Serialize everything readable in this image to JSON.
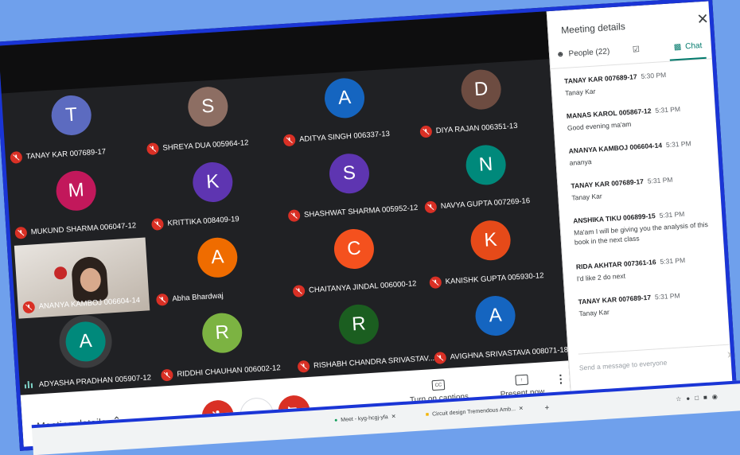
{
  "participants": [
    {
      "name": "TANAY KAR 007689-17",
      "initial": "T",
      "color": "#5c6bc0"
    },
    {
      "name": "SHREYA DUA 005964-12",
      "initial": "S",
      "color": "#8d6e63"
    },
    {
      "name": "ADITYA SINGH 006337-13",
      "initial": "A",
      "color": "#1565c0"
    },
    {
      "name": "DIYA RAJAN 006351-13",
      "initial": "D",
      "color": "#6d4c41"
    },
    {
      "name": "MUKUND SHARMA 006047-12",
      "initial": "M",
      "color": "#c2185b"
    },
    {
      "name": "KRITTIKA 008409-19",
      "initial": "K",
      "color": "#5e35b1"
    },
    {
      "name": "SHASHWAT SHARMA 005952-12",
      "initial": "S",
      "color": "#5e35b1"
    },
    {
      "name": "NAVYA GUPTA 007269-16",
      "initial": "N",
      "color": "#00897b"
    },
    {
      "name": "ANANYA KAMBOJ 006604-14",
      "initial": "",
      "color": "#000000"
    },
    {
      "name": "Abha Bhardwaj",
      "initial": "A",
      "color": "#ef6c00"
    },
    {
      "name": "CHAITANYA JINDAL 006000-12",
      "initial": "C",
      "color": "#f4511e"
    },
    {
      "name": "KANISHK GUPTA 005930-12",
      "initial": "K",
      "color": "#e64a19"
    },
    {
      "name": "ADYASHA PRADHAN 005907-12",
      "initial": "A",
      "color": "#00897b"
    },
    {
      "name": "RIDDHI CHAUHAN 006002-12",
      "initial": "R",
      "color": "#7cb342"
    },
    {
      "name": "RISHABH CHANDRA SRIVASTAV...",
      "initial": "R",
      "color": "#1b5e20"
    },
    {
      "name": "AVIGHNA SRIVASTAVA 008071-18",
      "initial": "A",
      "color": "#1565c0"
    }
  ],
  "bottom": {
    "meeting_details": "Meeting details",
    "captions": "Turn on captions",
    "captions_icon": "CC",
    "present": "Present now"
  },
  "side": {
    "title": "Meeting details",
    "people_tab": "People (22)",
    "chat_tab": "Chat",
    "send_placeholder": "Send a message to everyone"
  },
  "messages": [
    {
      "sender": "TANAY KAR 007689-17",
      "time": "5:30 PM",
      "text": "Tanay Kar"
    },
    {
      "sender": "MANAS KAROL 005867-12",
      "time": "5:31 PM",
      "text": "Good evening ma'am"
    },
    {
      "sender": "ANANYA KAMBOJ 006604-14",
      "time": "5:31 PM",
      "text": "ananya"
    },
    {
      "sender": "TANAY KAR 007689-17",
      "time": "5:31 PM",
      "text": "Tanay Kar"
    },
    {
      "sender": "ANSHIKA TIKU 006899-15",
      "time": "5:31 PM",
      "text": "Ma'am I will be giving you the analysis of this book in the next class"
    },
    {
      "sender": "RIDA AKHTAR 007361-16",
      "time": "5:31 PM",
      "text": "I'd like 2 do next"
    },
    {
      "sender": "TANAY KAR 007689-17",
      "time": "5:31 PM",
      "text": "Tanay Kar"
    }
  ],
  "taskbar": {
    "item1": "Meet - kyg-hcgj-yfa",
    "item2": "Circuit design Tremendous Amb..."
  },
  "colors": {
    "accent": "#00796b",
    "mute": "#d93025",
    "border": "#1a35d6"
  }
}
